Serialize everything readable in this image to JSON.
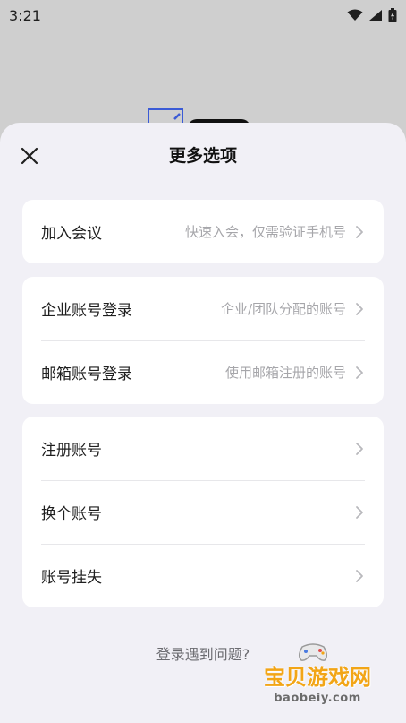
{
  "status_bar": {
    "time": "3:21"
  },
  "sheet": {
    "title": "更多选项",
    "groups": [
      [
        {
          "label": "加入会议",
          "hint": "快速入会，仅需验证手机号"
        }
      ],
      [
        {
          "label": "企业账号登录",
          "hint": "企业/团队分配的账号"
        },
        {
          "label": "邮箱账号登录",
          "hint": "使用邮箱注册的账号"
        }
      ],
      [
        {
          "label": "注册账号"
        },
        {
          "label": "换个账号"
        },
        {
          "label": "账号挂失"
        }
      ]
    ],
    "help_link": "登录遇到问题?"
  },
  "watermark": {
    "title": "宝贝游戏网",
    "url": "baobeiy.com"
  },
  "colors": {
    "sheet_bg": "#f1f0f6",
    "card_bg": "#ffffff",
    "hint": "#a6a6aa",
    "watermark": "#f2a516"
  }
}
